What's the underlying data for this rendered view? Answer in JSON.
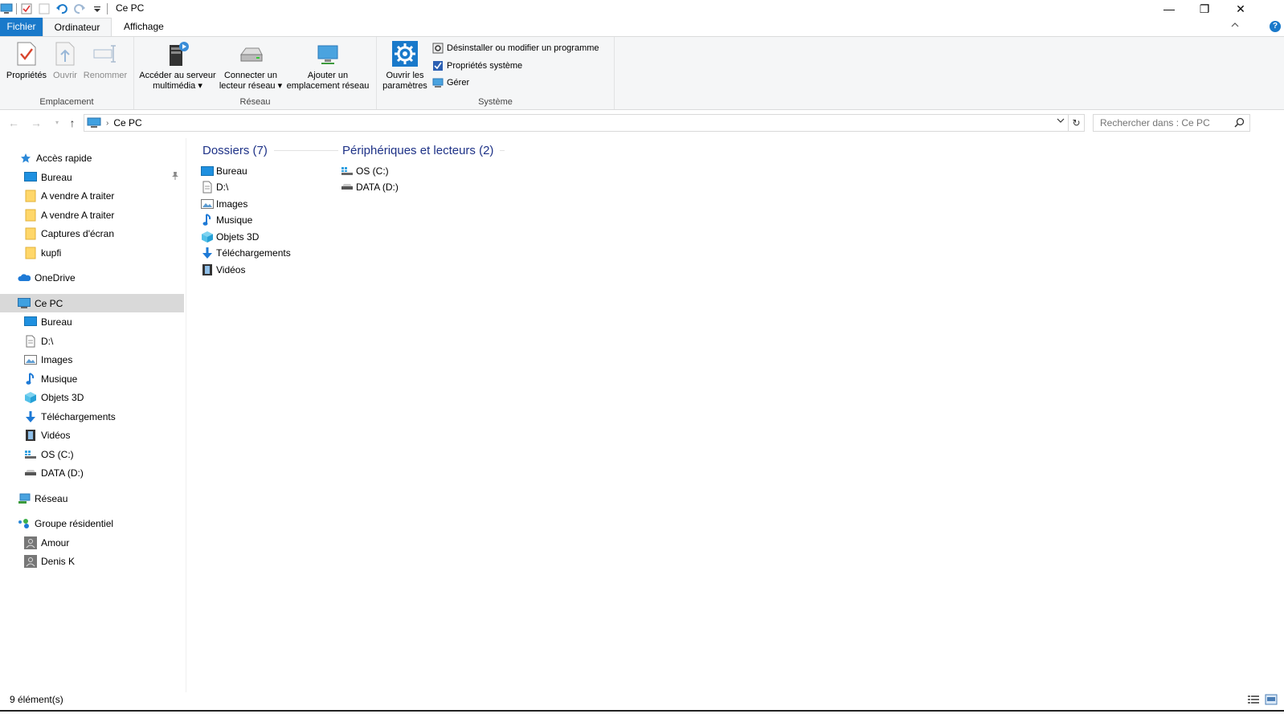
{
  "window": {
    "title": "Ce PC",
    "minimize_glyph": "—",
    "restore_glyph": "❐",
    "close_glyph": "✕"
  },
  "ribbon_tabs": {
    "file": "Fichier",
    "computer": "Ordinateur",
    "view": "Affichage",
    "help": "?"
  },
  "ribbon": {
    "emplacement": {
      "label": "Emplacement",
      "properties": "Propriétés",
      "open": "Ouvrir",
      "rename": "Renommer"
    },
    "reseau": {
      "label": "Réseau",
      "media_line1": "Accéder au serveur",
      "media_line2": "multimédia",
      "map_line1": "Connecter un",
      "map_line2": "lecteur réseau",
      "add_line1": "Ajouter un",
      "add_line2": "emplacement réseau"
    },
    "systeme": {
      "label": "Système",
      "settings_line1": "Ouvrir les",
      "settings_line2": "paramètres",
      "uninstall": "Désinstaller ou modifier un programme",
      "sysprops": "Propriétés système",
      "manage": "Gérer"
    }
  },
  "address": {
    "path": "Ce PC",
    "search_placeholder": "Rechercher dans : Ce PC"
  },
  "navpane": {
    "quick_access": "Accès rapide",
    "quick_items": [
      "Bureau",
      "A vendre A traiter",
      "A vendre A traiter",
      "Captures d'écran",
      "kupfi"
    ],
    "onedrive": "OneDrive",
    "this_pc": "Ce PC",
    "pc_items": [
      "Bureau",
      "D:\\",
      "Images",
      "Musique",
      "Objets 3D",
      "Téléchargements",
      "Vidéos",
      "OS (C:)",
      "DATA (D:)"
    ],
    "network": "Réseau",
    "homegroup": "Groupe résidentiel",
    "homegroup_items": [
      "Amour",
      "Denis K"
    ]
  },
  "content": {
    "folders_header": "Dossiers (7)",
    "folders": [
      "Bureau",
      "D:\\",
      "Images",
      "Musique",
      "Objets 3D",
      "Téléchargements",
      "Vidéos"
    ],
    "devices_header": "Périphériques et lecteurs (2)",
    "devices": [
      "OS (C:)",
      "DATA (D:)"
    ]
  },
  "status": {
    "count": "9 élément(s)"
  },
  "colors": {
    "accent": "#1979ca",
    "group_header": "#1e3287",
    "selection": "#d9d9d9"
  }
}
